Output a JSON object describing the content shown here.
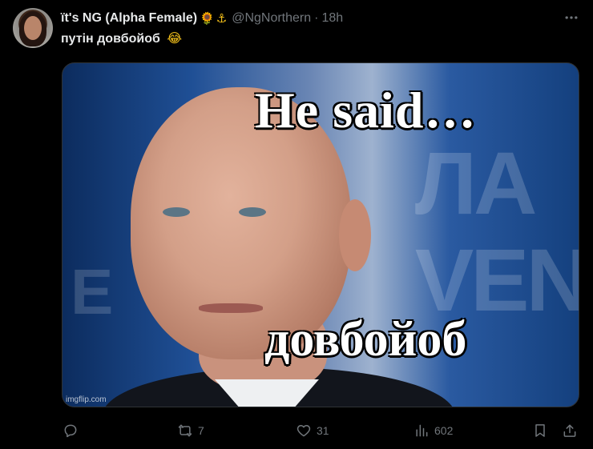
{
  "author": {
    "display_name": "ït's NG (Alpha Female)",
    "emoji_1": "🌻",
    "emoji_2": "⚓",
    "handle": "@NgNorthern",
    "separator": "·",
    "time": "18h"
  },
  "tweet": {
    "text": "путін довбойоб",
    "emoji": "😂"
  },
  "media": {
    "meme_top_text": "He said…",
    "meme_bottom_text": "довбойоб",
    "watermark": "imgflip.com"
  },
  "actions": {
    "reply": {
      "icon": "reply-icon",
      "count": ""
    },
    "retweet": {
      "icon": "retweet-icon",
      "count": "7"
    },
    "like": {
      "icon": "heart-icon",
      "count": "31"
    },
    "views": {
      "icon": "views-icon",
      "count": "602"
    },
    "bookmark": {
      "icon": "bookmark-icon"
    },
    "share": {
      "icon": "share-icon"
    }
  },
  "colors": {
    "background": "#000000",
    "text": "#e7e9ea",
    "muted": "#71767b",
    "border": "#2f3336"
  }
}
